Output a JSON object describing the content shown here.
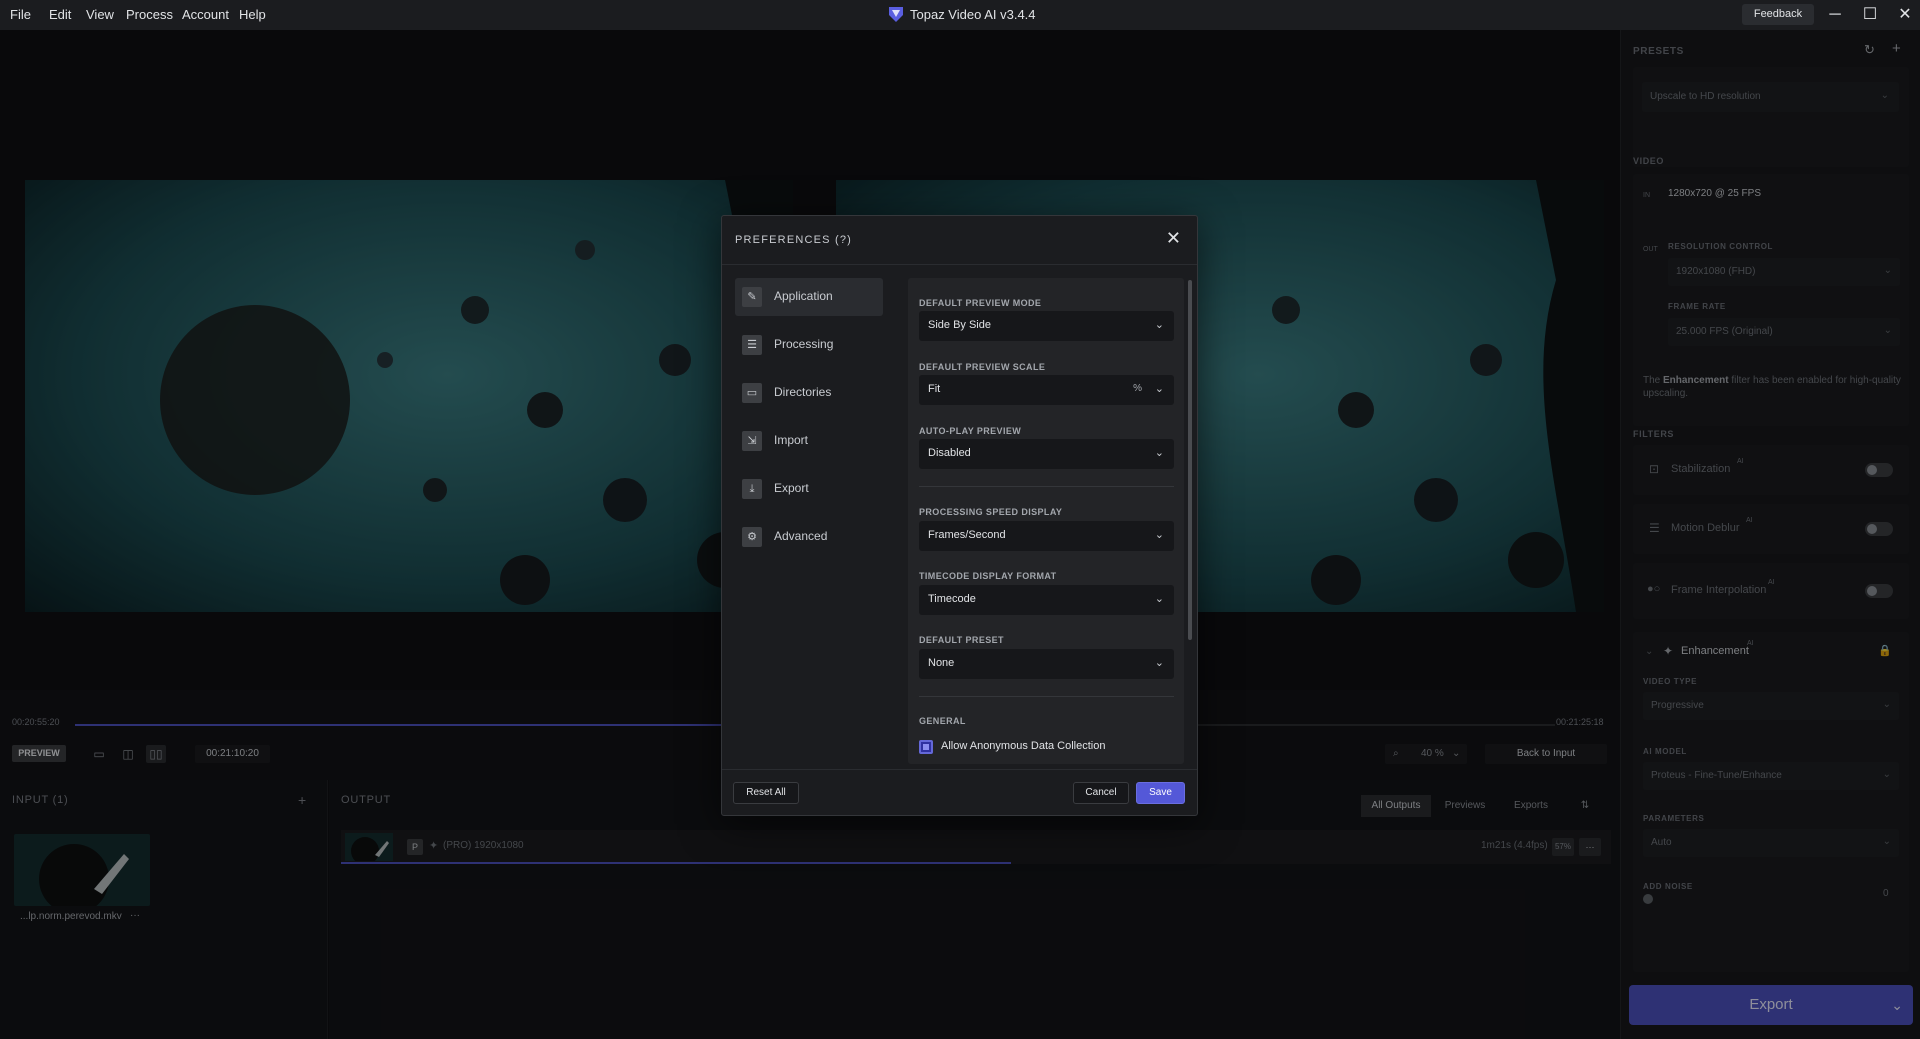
{
  "menu": [
    "File",
    "Edit",
    "View",
    "Process",
    "Account",
    "Help"
  ],
  "app": {
    "title": "Topaz Video AI  v3.4.4",
    "feedback": "Feedback"
  },
  "window_controls": {
    "minimize": "─",
    "maximize": "☐",
    "close": "✕"
  },
  "timeline": {
    "start": "00:20:55:20",
    "end": "00:21:25:18",
    "preview_badge": "PREVIEW",
    "current_timecode": "00:21:10:20",
    "zoom": "40 %",
    "back_to_input": "Back to Input"
  },
  "input": {
    "title": "INPUT (1)",
    "add": "+",
    "file_name": "...lp.norm.perevod.mkv",
    "more": "···"
  },
  "output": {
    "title": "OUTPUT",
    "tabs": [
      "All Outputs",
      "Previews",
      "Exports"
    ],
    "row_badge": "P",
    "row_label": "(PRO) 1920x1080",
    "row_eta": "1m21s (4.4fps)",
    "row_pct": "57%",
    "row_more": "···"
  },
  "right_panel": {
    "presets_label": "PRESETS",
    "preset_value": "Upscale to HD resolution",
    "video_label": "VIDEO",
    "in_tag": "IN",
    "in_resolution": "1280x720 @ 25 FPS",
    "out_tag": "OUT",
    "resolution_control_label": "RESOLUTION CONTROL",
    "resolution_value": "1920x1080 (FHD)",
    "frame_rate_label": "FRAME RATE",
    "frame_rate_value": "25.000 FPS (Original)",
    "enhancement_note_pre": "The ",
    "enhancement_note_bold": "Enhancement",
    "enhancement_note_post": " filter has been enabled for high-quality upscaling.",
    "filters_label": "FILTERS",
    "filters": [
      "Stabilization",
      "Motion Deblur",
      "Frame Interpolation"
    ],
    "ai_sup": "AI",
    "enhancement_title": "Enhancement",
    "video_type_label": "VIDEO TYPE",
    "video_type_value": "Progressive",
    "ai_model_label": "AI MODEL",
    "ai_model_value": "Proteus - Fine-Tune/Enhance",
    "parameters_label": "PARAMETERS",
    "parameters_value": "Auto",
    "add_noise_label": "ADD NOISE",
    "add_noise_value": "0",
    "export_label": "Export"
  },
  "dialog": {
    "title": "PREFERENCES  (?)",
    "close": "✕",
    "nav": [
      {
        "label": "Application",
        "icon": "application-icon",
        "glyph": "✎"
      },
      {
        "label": "Processing",
        "icon": "processing-icon",
        "glyph": "☰"
      },
      {
        "label": "Directories",
        "icon": "folder-icon",
        "glyph": "▭"
      },
      {
        "label": "Import",
        "icon": "import-icon",
        "glyph": "⇲"
      },
      {
        "label": "Export",
        "icon": "export-icon",
        "glyph": "⤓"
      },
      {
        "label": "Advanced",
        "icon": "advanced-icon",
        "glyph": "⚙"
      }
    ],
    "fields": {
      "preview_mode": {
        "label": "DEFAULT PREVIEW MODE",
        "value": "Side By Side"
      },
      "preview_scale": {
        "label": "DEFAULT PREVIEW SCALE",
        "value": "Fit",
        "unit": "%"
      },
      "autoplay": {
        "label": "AUTO-PLAY PREVIEW",
        "value": "Disabled"
      },
      "speed_display": {
        "label": "PROCESSING SPEED DISPLAY",
        "value": "Frames/Second"
      },
      "timecode_format": {
        "label": "TIMECODE DISPLAY FORMAT",
        "value": "Timecode"
      },
      "default_preset": {
        "label": "DEFAULT PRESET",
        "value": "None"
      }
    },
    "general_label": "GENERAL",
    "anon_data_label": "Allow Anonymous Data Collection",
    "anon_data_checked": true,
    "reset_all": "Reset All",
    "cancel": "Cancel",
    "save": "Save",
    "accent_color": "#5458d8"
  }
}
